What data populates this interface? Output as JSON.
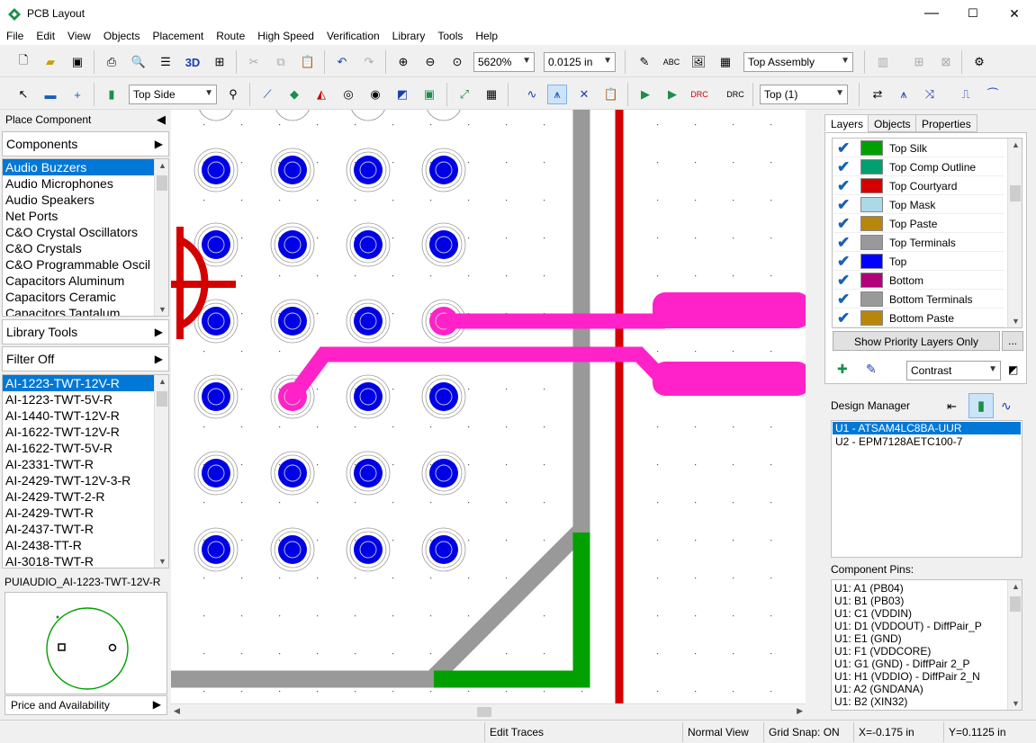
{
  "window": {
    "title": "PCB Layout",
    "minimize": "—",
    "maximize": "☐",
    "close": "✕"
  },
  "menu": [
    "File",
    "Edit",
    "View",
    "Objects",
    "Placement",
    "Route",
    "High Speed",
    "Verification",
    "Library",
    "Tools",
    "Help"
  ],
  "toolbar1": {
    "zoom_value": "5620%",
    "grid_value": "0.0125 in",
    "view_value": "Top Assembly",
    "label_3d": "3D"
  },
  "toolbar2": {
    "side_value": "Top Side",
    "layer_value": "Top (1)"
  },
  "left_panel": {
    "place_component": "Place Component",
    "components_header": "Components",
    "categories": [
      "Audio Buzzers",
      "Audio Microphones",
      "Audio Speakers",
      "Net Ports",
      "C&O Crystal Oscillators",
      "C&O Crystals",
      "C&O Programmable Oscil",
      "Capacitors Aluminum",
      "Capacitors Ceramic",
      "Capacitors Tantalum"
    ],
    "selected_category": 0,
    "library_tools": "Library Tools",
    "filter": "Filter Off",
    "parts": [
      "AI-1223-TWT-12V-R",
      "AI-1223-TWT-5V-R",
      "AI-1440-TWT-12V-R",
      "AI-1622-TWT-12V-R",
      "AI-1622-TWT-5V-R",
      "AI-2331-TWT-R",
      "AI-2429-TWT-12V-3-R",
      "AI-2429-TWT-2-R",
      "AI-2429-TWT-R",
      "AI-2437-TWT-R",
      "AI-2438-TT-R",
      "AI-3018-TWT-R"
    ],
    "selected_part": 0,
    "preview_name": "PUIAUDIO_AI-1223-TWT-12V-R",
    "price_availability": "Price and Availability"
  },
  "right_panel": {
    "tabs": [
      "Layers",
      "Objects",
      "Properties"
    ],
    "active_tab": 0,
    "layers": [
      {
        "name": "Top Silk",
        "color": "#00a000"
      },
      {
        "name": "Top Comp Outline",
        "color": "#00a070"
      },
      {
        "name": "Top Courtyard",
        "color": "#d40000"
      },
      {
        "name": "Top Mask",
        "color": "#add8e6"
      },
      {
        "name": "Top Paste",
        "color": "#b8860b"
      },
      {
        "name": "Top Terminals",
        "color": "#999999"
      },
      {
        "name": "Top",
        "color": "#0000ff"
      },
      {
        "name": "Bottom",
        "color": "#b0007a"
      },
      {
        "name": "Bottom Terminals",
        "color": "#999999"
      },
      {
        "name": "Bottom Paste",
        "color": "#b8860b"
      }
    ],
    "show_priority": "Show Priority Layers Only",
    "more_button": "...",
    "contrast_value": "Contrast",
    "design_manager": "Design Manager",
    "components": [
      "U1 - ATSAM4LC8BA-UUR",
      "U2 - EPM7128AETC100-7"
    ],
    "selected_component": 0,
    "component_pins_label": "Component Pins:",
    "pins": [
      "U1: A1 (PB04)",
      "U1: B1 (PB03)",
      "U1: C1 (VDDIN)",
      "U1: D1 (VDDOUT) - DiffPair_P",
      "U1: E1 (GND)",
      "U1: F1 (VDDCORE)",
      "U1: G1 (GND) - DiffPair 2_P",
      "U1: H1 (VDDIO) - DiffPair 2_N",
      "U1: A2 (GNDANA)",
      "U1: B2 (XIN32)"
    ]
  },
  "status": {
    "mode": "Edit Traces",
    "view": "Normal View",
    "snap": "Grid Snap: ON",
    "x": "X=-0.175 in",
    "y": "Y=0.1125 in"
  },
  "colors": {
    "pad": "#0000e6",
    "pad_highlight": "#ff22c8",
    "trace_pink": "#ff22c8",
    "trace_gray": "#999999",
    "trace_green": "#00a000",
    "trace_red": "#d40000",
    "selection": "#0078d7"
  }
}
